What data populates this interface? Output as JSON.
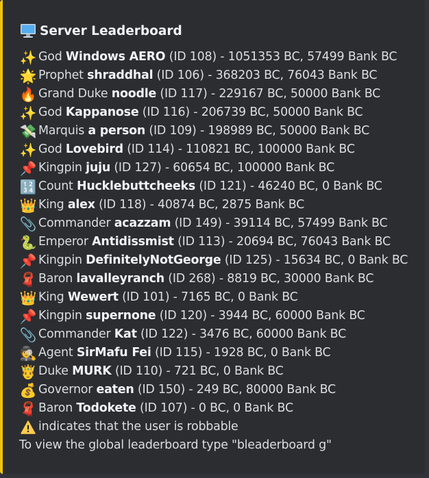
{
  "accent_color": "#f1c40f",
  "title": {
    "icon": "desktop-computer-icon",
    "text": "Server Leaderboard"
  },
  "entries": [
    {
      "icon": "sparkles-icon",
      "glyph": "✨",
      "rank": "God",
      "name": "Windows AERO",
      "rest": "(ID 108) - 1051353 BC, 57499 Bank BC"
    },
    {
      "icon": "sun-icon",
      "glyph": "🌟",
      "rank": "Prophet",
      "name": "shraddhal",
      "rest": "(ID 106) - 368203 BC, 76043 Bank BC"
    },
    {
      "icon": "fire-icon",
      "glyph": "🔥",
      "rank": "Grand Duke",
      "name": "noodle",
      "rest": "(ID 117) - 229167 BC, 50000 Bank BC"
    },
    {
      "icon": "sparkles-icon",
      "glyph": "✨",
      "rank": "God",
      "name": "Kappanose",
      "rest": "(ID 116) - 206739 BC, 50000 Bank BC"
    },
    {
      "icon": "money-with-wings-icon",
      "glyph": "💸",
      "rank": "Marquis",
      "name": "a person",
      "rest": "(ID 109) - 198989 BC, 50000 Bank BC"
    },
    {
      "icon": "sparkles-icon",
      "glyph": "✨",
      "rank": "God",
      "name": "Lovebird",
      "rest": "(ID 114) - 110821 BC, 100000 Bank BC"
    },
    {
      "icon": "pushpin-icon",
      "glyph": "📌",
      "rank": "Kingpin",
      "name": "juju",
      "rest": "(ID 127) - 60654 BC, 100000 Bank BC"
    },
    {
      "icon": "numbers-icon",
      "glyph": "🔢",
      "rank": "Count",
      "name": "Hucklebuttcheeks",
      "rest": "(ID 121) - 46240 BC, 0 Bank BC"
    },
    {
      "icon": "crown-icon",
      "glyph": "👑",
      "rank": "King",
      "name": "alex",
      "rest": "(ID 118) - 40874 BC, 2875 Bank BC"
    },
    {
      "icon": "paperclip-icon",
      "glyph": "📎",
      "rank": "Commander",
      "name": "acazzam",
      "rest": "(ID 149) - 39114 BC, 57499 Bank BC"
    },
    {
      "icon": "serpent-icon",
      "glyph": "🐍",
      "rank": "Emperor",
      "name": "Antidissmist",
      "rest": "(ID 113) - 20694 BC, 76043 Bank BC"
    },
    {
      "icon": "pushpin-icon",
      "glyph": "📌",
      "rank": "Kingpin",
      "name": "DefinitelyNotGeorge",
      "rest": "(ID 125) - 15634 BC, 0 Bank BC"
    },
    {
      "icon": "scarf-icon",
      "glyph": "🧣",
      "rank": "Baron",
      "name": "lavalleyranch",
      "rest": "(ID 268) - 8819 BC, 30000 Bank BC"
    },
    {
      "icon": "crown-icon",
      "glyph": "👑",
      "rank": "King",
      "name": "Wewert",
      "rest": "(ID 101) - 7165 BC, 0 Bank BC"
    },
    {
      "icon": "pushpin-icon",
      "glyph": "📌",
      "rank": "Kingpin",
      "name": "supernone",
      "rest": "(ID 120) - 3944 BC, 60000 Bank BC"
    },
    {
      "icon": "paperclip-icon",
      "glyph": "📎",
      "rank": "Commander",
      "name": "Kat",
      "rest": "(ID 122) - 3476 BC, 60000 Bank BC"
    },
    {
      "icon": "detective-icon",
      "glyph": "🕵",
      "rank": "Agent",
      "name": "SirMafu Fei",
      "rest": "(ID 115) - 1928 BC, 0 Bank BC"
    },
    {
      "icon": "prince-icon",
      "glyph": "🤴",
      "rank": "Duke",
      "name": "MURK",
      "rest": "(ID 110) - 721 BC, 0 Bank BC"
    },
    {
      "icon": "money-bag-icon",
      "glyph": "💰",
      "rank": "Governor",
      "name": "eaten",
      "rest": "(ID 150) - 249 BC, 80000 Bank BC"
    },
    {
      "icon": "scarf-icon",
      "glyph": "🧣",
      "rank": "Baron",
      "name": "Todokete",
      "rest": "(ID 107) - 0 BC, 0 Bank BC"
    }
  ],
  "warning": {
    "icon": "warning-icon",
    "text": "indicates that the user is robbable"
  },
  "footer": "To view the global leaderboard type \"bleaderboard g\""
}
